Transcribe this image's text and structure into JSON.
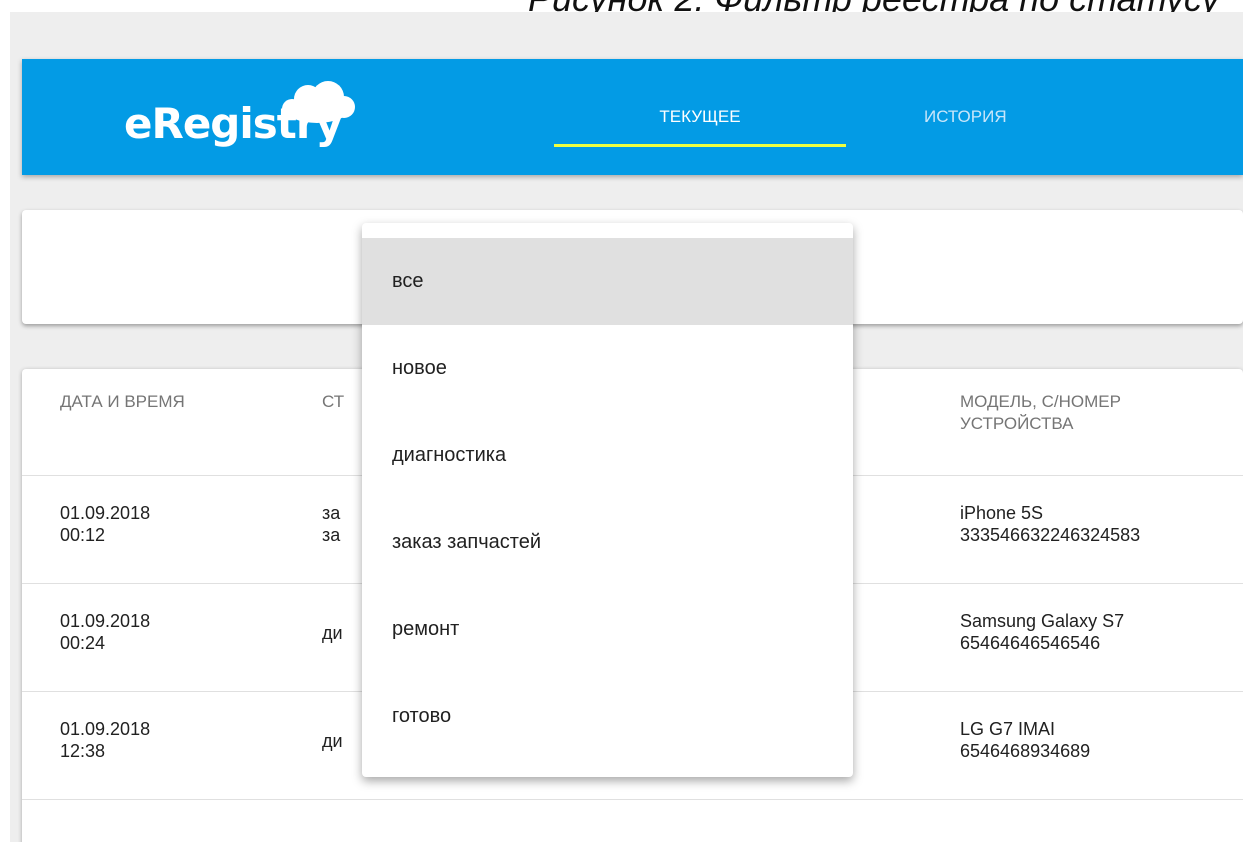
{
  "figure_caption": "Рисунок 2. Фильтр реестра по статусу",
  "app": {
    "logo_text": "eRegistry"
  },
  "nav": {
    "tabs": [
      {
        "label": "ТЕКУЩЕЕ",
        "active": true
      },
      {
        "label": "ИСТОРИЯ",
        "active": false
      }
    ]
  },
  "table": {
    "headers": {
      "datetime": "ДАТА И ВРЕМЯ",
      "status": "СТ",
      "model": "МОДЕЛЬ, С/НОМЕР УСТРОЙСТВА"
    },
    "rows": [
      {
        "date": "01.09.2018",
        "time": "00:12",
        "status": "за\nза",
        "model": "iPhone 5S",
        "serial": "333546632246324583"
      },
      {
        "date": "01.09.2018",
        "time": "00:24",
        "status": "ди",
        "model": "Samsung Galaxy S7",
        "serial": "65464646546546"
      },
      {
        "date": "01.09.2018",
        "time": "12:38",
        "status": "ди",
        "model": "LG G7 IMAI",
        "serial": "6546468934689"
      }
    ]
  },
  "status_filter": {
    "selected": "все",
    "options": [
      "все",
      "новое",
      "диагностика",
      "заказ запчастей",
      "ремонт",
      "готово"
    ]
  },
  "colors": {
    "header_bg": "#039be5",
    "tab_indicator": "#eeff41",
    "selected_option_bg": "#e0e0e0",
    "page_bg": "#eeeeee"
  }
}
